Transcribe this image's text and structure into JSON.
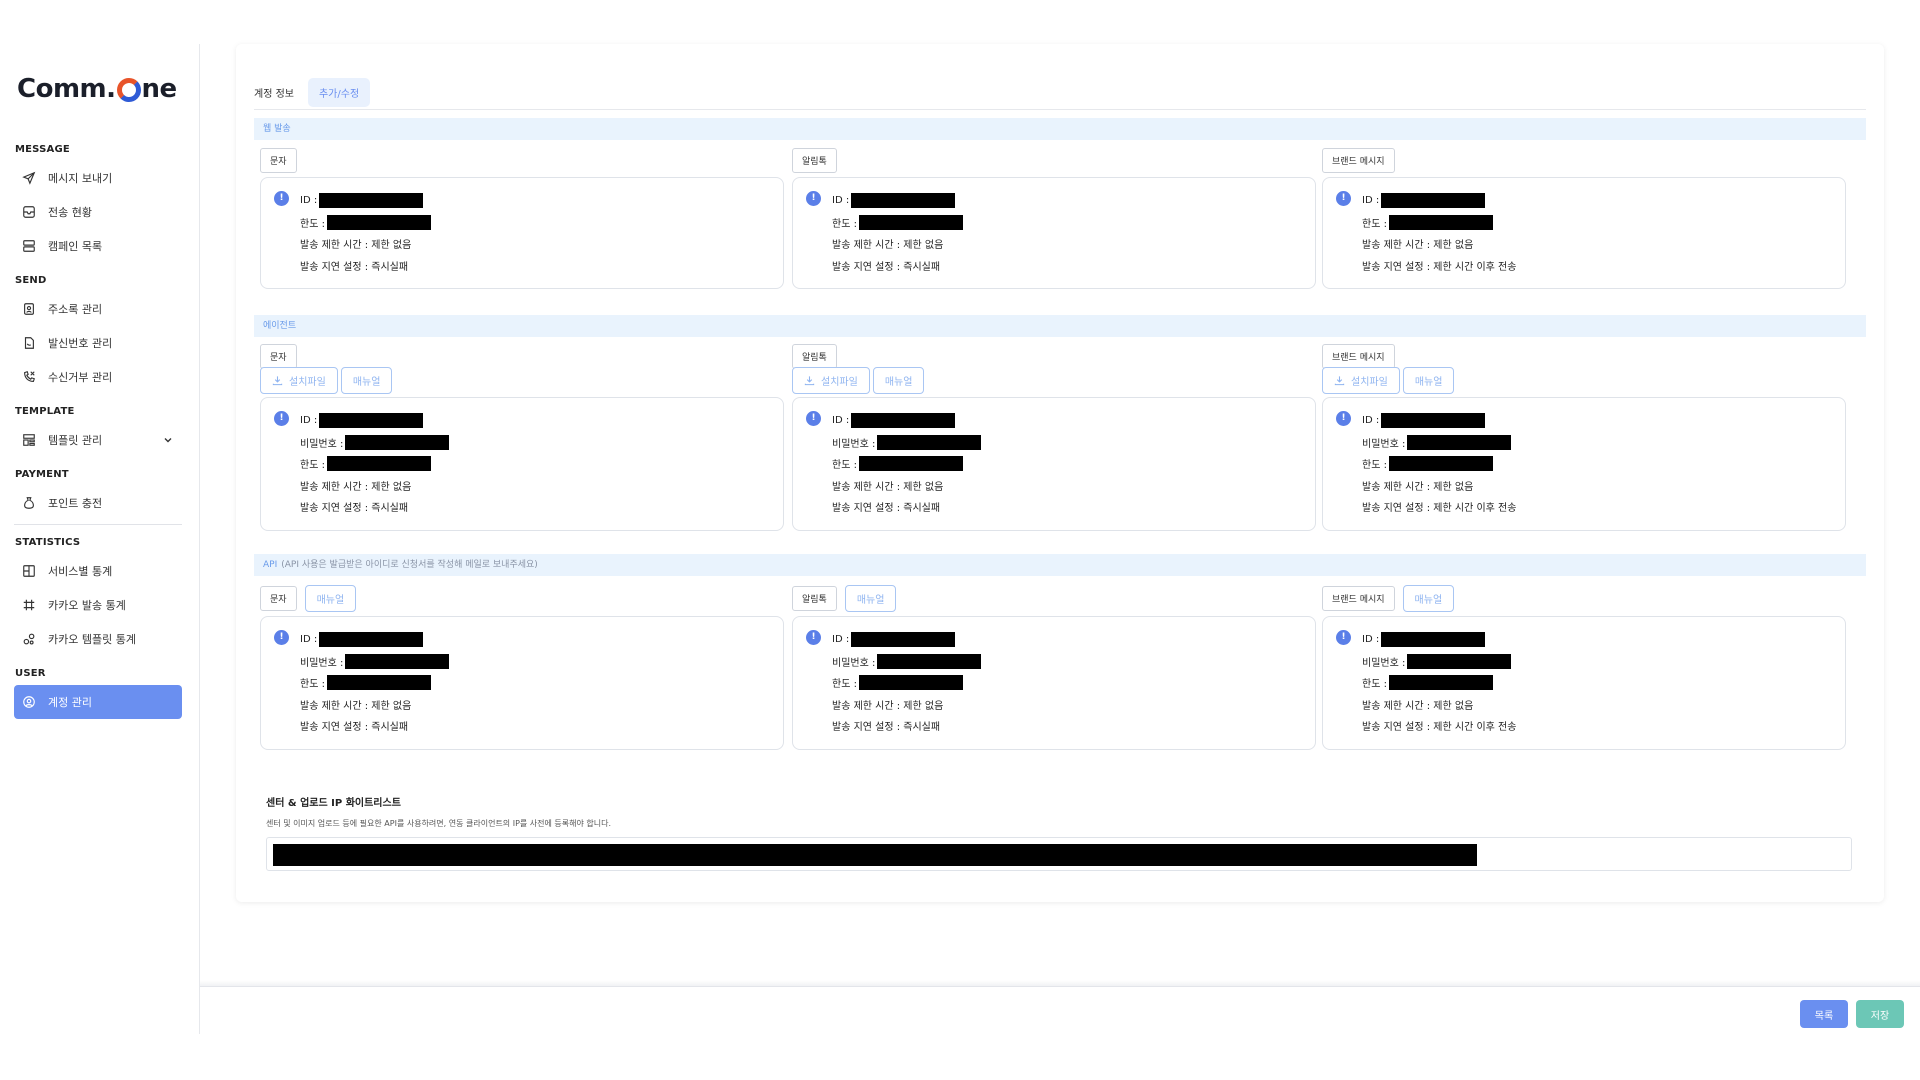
{
  "logo": {
    "text_before": "Comm.",
    "text_after": "ne"
  },
  "sidebar": {
    "sections": [
      {
        "title": "MESSAGE",
        "items": [
          {
            "label": "메시지 보내기",
            "icon": "send-icon"
          },
          {
            "label": "전송 현황",
            "icon": "status-icon"
          },
          {
            "label": "캠페인 목록",
            "icon": "list-icon"
          }
        ]
      },
      {
        "title": "SEND",
        "items": [
          {
            "label": "주소록 관리",
            "icon": "address-book-icon"
          },
          {
            "label": "발신번호 관리",
            "icon": "sender-number-icon"
          },
          {
            "label": "수신거부 관리",
            "icon": "phone-block-icon"
          }
        ]
      },
      {
        "title": "TEMPLATE",
        "items": [
          {
            "label": "템플릿 관리",
            "icon": "template-icon"
          }
        ]
      },
      {
        "title": "PAYMENT",
        "items": [
          {
            "label": "포인트 충전",
            "icon": "point-icon"
          }
        ]
      },
      {
        "title": "STATISTICS",
        "items": [
          {
            "label": "서비스별 통계",
            "icon": "service-stats-icon"
          },
          {
            "label": "카카오 발송 통계",
            "icon": "kakao-stats-icon"
          },
          {
            "label": "카카오 템플릿 통계",
            "icon": "kakao-template-stats-icon"
          }
        ]
      },
      {
        "title": "USER",
        "items": [
          {
            "label": "계정 관리",
            "icon": "account-icon",
            "active": true
          }
        ]
      }
    ]
  },
  "tabs": {
    "account_info": "계정 정보",
    "add_edit": "추가/수정"
  },
  "sections": {
    "web": {
      "title": "웹 발송"
    },
    "agent": {
      "title": "에이전트"
    },
    "api": {
      "title": "API",
      "note": "(API 사용은 발급받은 아이디로 신청서를 작성해 메일로 보내주세요)"
    }
  },
  "channels": {
    "sms": "문자",
    "alimtalk": "알림톡",
    "brand": "브랜드 메시지"
  },
  "buttons": {
    "install": "설치파일",
    "manual": "매뉴얼",
    "list": "목록",
    "save": "저장"
  },
  "labels": {
    "id": "ID :",
    "password": "비밀번호 :",
    "limit": "한도 :",
    "badge": "!",
    "time_limit": "발송 제한 시간 : 제한 없음",
    "delay_fail": "발송 지연 설정 : 즉시실패",
    "delay_after": "발송 지연 설정 : 제한 시간 이후 전송"
  },
  "whitelist": {
    "title": "센터 & 업로드 IP 화이트리스트",
    "desc": "센터 및 이미지 업로드 등에 필요한 API를 사용하려면, 연동 클라이언트의 IP를 사전에 등록해야 합니다."
  }
}
